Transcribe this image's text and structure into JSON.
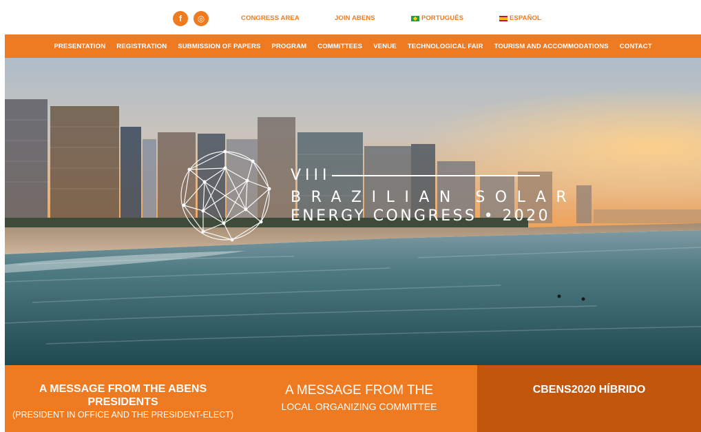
{
  "topbar": {
    "social": [
      {
        "icon": "facebook-icon",
        "glyph": "f"
      },
      {
        "icon": "instagram-icon",
        "glyph": "◎"
      }
    ],
    "links": {
      "congress_area": "CONGRESS AREA",
      "join_abens": "JOIN ABENS",
      "portugues": "PORTUGUÊS",
      "espanol": "ESPAÑOL"
    }
  },
  "nav": {
    "items": [
      "PRESENTATION",
      "REGISTRATION",
      "SUBMISSION OF PAPERS",
      "PROGRAM",
      "COMMITTEES",
      "VENUE",
      "TECHNOLOGICAL FAIR",
      "TOURISM AND ACCOMMODATIONS",
      "CONTACT"
    ]
  },
  "hero": {
    "line1": "VIII",
    "line2": "BRAZILIAN SOLAR",
    "line3": "ENERGY CONGRESS • 2020"
  },
  "panels": {
    "abens": {
      "title": "A MESSAGE FROM THE ABENS PRESIDENTS",
      "subtitle": "(PRESIDENT IN OFFICE AND THE PRESIDENT-ELECT)"
    },
    "committee": {
      "title": "A MESSAGE FROM THE",
      "subtitle": "LOCAL ORGANIZING COMMITTEE"
    },
    "hybrid": {
      "title": "CBENS2020 HÍBRIDO"
    }
  },
  "colors": {
    "brand_orange": "#ee7a22",
    "dark_orange": "#c2560c"
  }
}
